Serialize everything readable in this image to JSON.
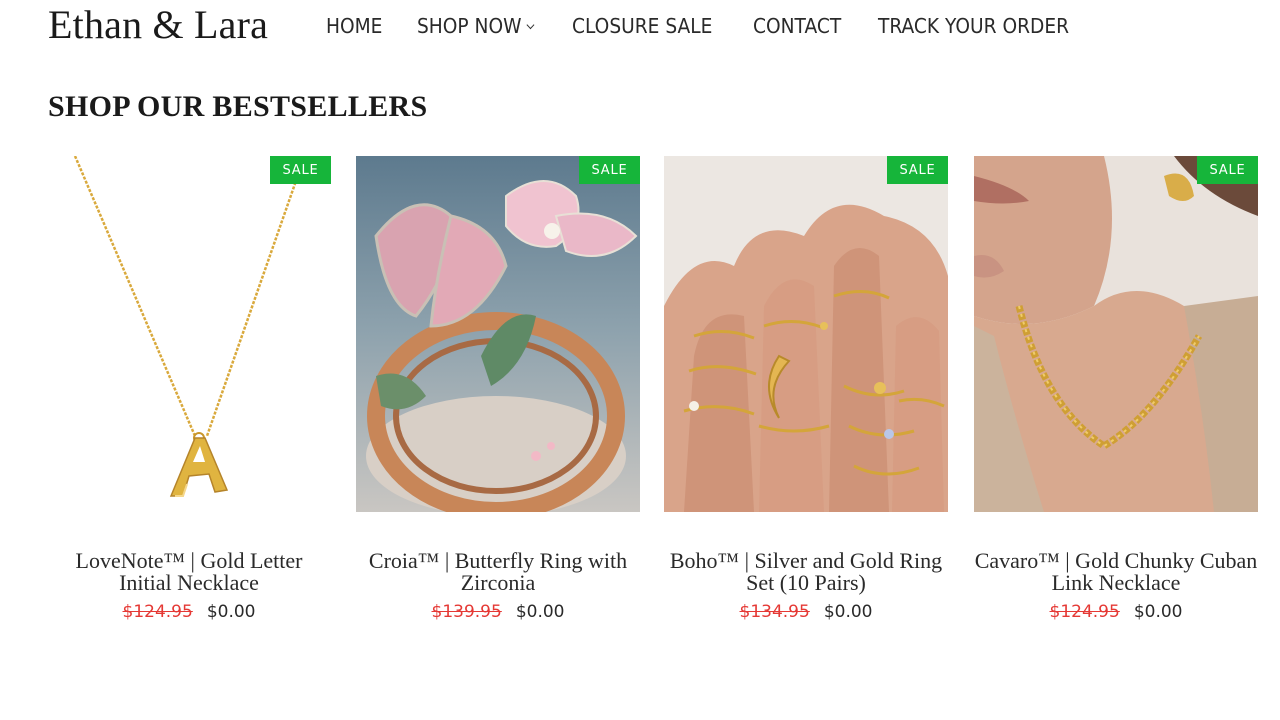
{
  "header": {
    "logo": "Ethan & Lara",
    "nav": [
      {
        "label": "HOME"
      },
      {
        "label": "SHOP NOW"
      },
      {
        "label": "CLOSURE SALE"
      },
      {
        "label": "CONTACT"
      },
      {
        "label": "TRACK YOUR ORDER"
      }
    ]
  },
  "section": {
    "title": "SHOP OUR BESTSELLERS"
  },
  "products": [
    {
      "badge": "SALE",
      "name": "LoveNote™ | Gold Letter Initial Necklace",
      "old_price": "$124.95",
      "price": "$0.00",
      "image": "gold-letter-necklace-image"
    },
    {
      "badge": "SALE",
      "name": "Croia™ | Butterfly Ring with Zirconia",
      "old_price": "$139.95",
      "price": "$0.00",
      "image": "butterfly-ring-image"
    },
    {
      "badge": "SALE",
      "name": "Boho™ | Silver and Gold Ring Set (10 Pairs)",
      "old_price": "$134.95",
      "price": "$0.00",
      "image": "ring-set-image"
    },
    {
      "badge": "SALE",
      "name": "Cavaro™ | Gold Chunky Cuban Link Necklace",
      "old_price": "$124.95",
      "price": "$0.00",
      "image": "cuban-link-necklace-image"
    }
  ],
  "colors": {
    "sale_badge": "#16b53a",
    "old_price": "#e53935",
    "text": "#2a2a2a"
  }
}
